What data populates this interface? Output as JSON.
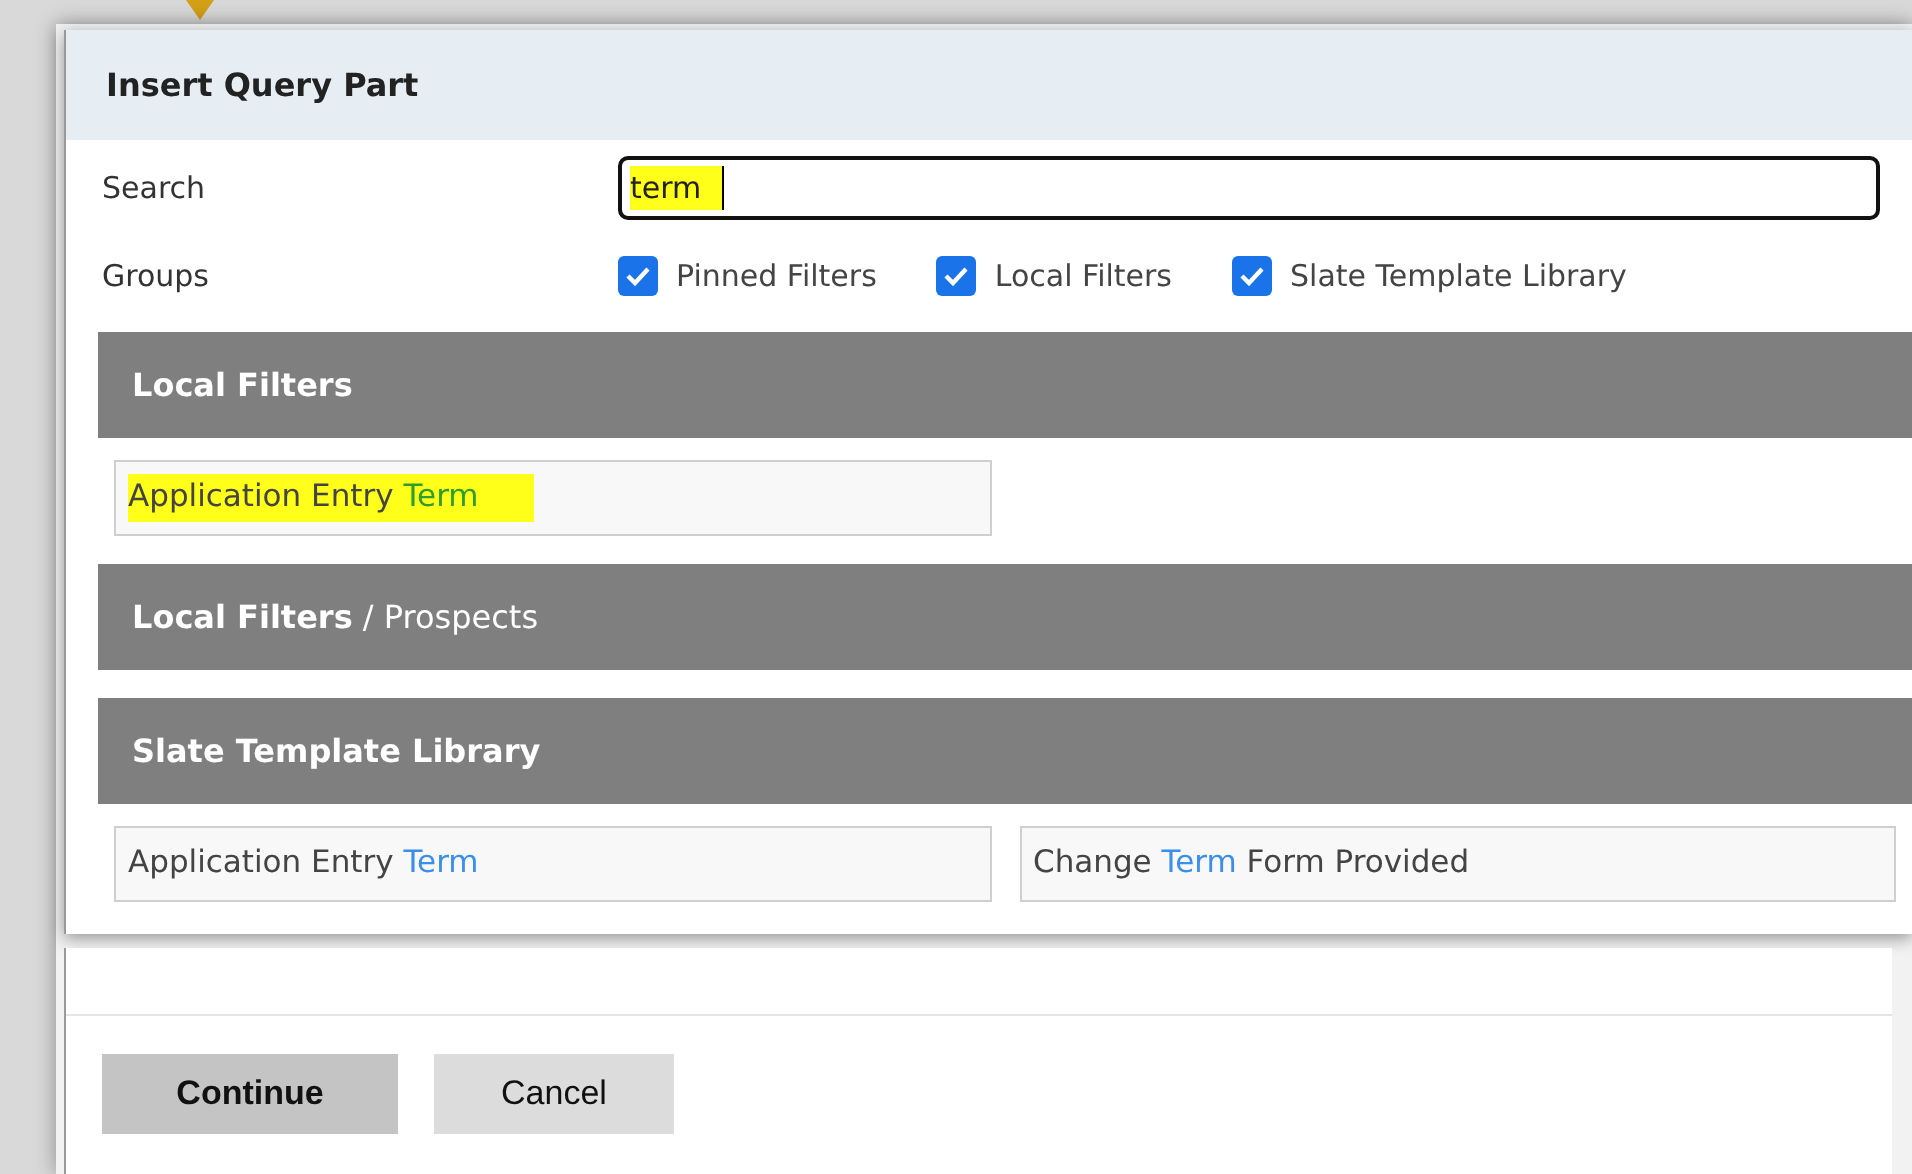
{
  "dialog": {
    "title": "Insert Query Part"
  },
  "search": {
    "label": "Search",
    "value": "term",
    "highlighted": true
  },
  "groups": {
    "label": "Groups",
    "options": [
      {
        "label": "Pinned Filters",
        "checked": true
      },
      {
        "label": "Local Filters",
        "checked": true
      },
      {
        "label": "Slate Template Library",
        "checked": true
      }
    ]
  },
  "sections": [
    {
      "title": "Local Filters",
      "results": [
        {
          "before": "Application Entry ",
          "match": "Term",
          "color": "#2e9e2e",
          "highlighted": true
        }
      ]
    },
    {
      "title": "Local Filters",
      "subtitle": "/ Prospects"
    },
    {
      "title": "Slate Template Library",
      "results": [
        {
          "before": "Application Entry ",
          "match": "Term",
          "color": "#3b8fe8",
          "highlighted": false
        },
        {
          "before": "Change ",
          "match": "Term",
          "after": " Form Provided",
          "color": "#3b8fe8",
          "highlighted": false
        }
      ]
    }
  ],
  "buttons": [
    {
      "label": "Continue",
      "kind": "primary"
    },
    {
      "label": "Cancel",
      "kind": "secondary"
    }
  ]
}
